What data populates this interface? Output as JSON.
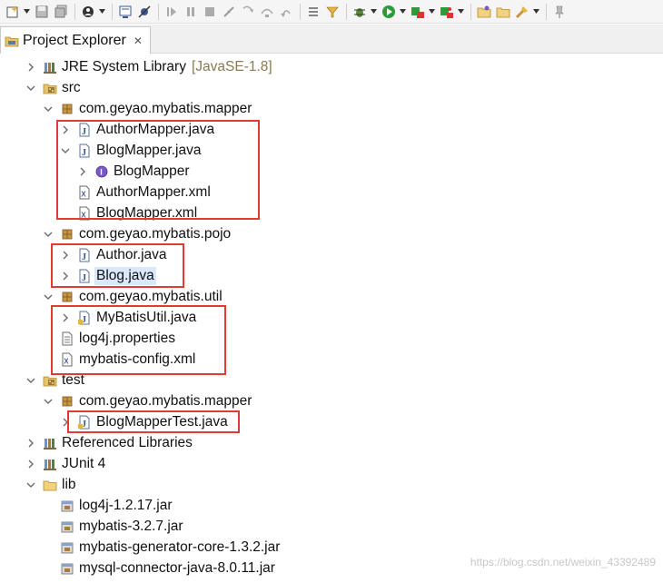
{
  "colors": {
    "highlight_box": "#e53935",
    "selection_bg": "#d9e8fb",
    "decoration": "#8a7a55",
    "package_icon": "#b07a2d",
    "java_icon": "#4a6aa5",
    "interface_icon": "#7a4dbd"
  },
  "toolbar": {
    "buttons": [
      "new-wizard-icon",
      "save-icon",
      "save-all-icon",
      "perspective-icon",
      "console-icon",
      "skip-breakpoints-icon",
      "resume-icon",
      "suspend-icon",
      "terminate-icon",
      "disconnect-icon",
      "step-into-icon",
      "step-over-icon",
      "step-return-icon",
      "drop-to-frame-icon",
      "use-step-filters-icon",
      "debug-icon",
      "run-icon",
      "coverage-icon",
      "external-tools-icon",
      "open-type-icon",
      "open-task-icon",
      "search-icon",
      "pin-icon"
    ]
  },
  "tab": {
    "label": "Project Explorer",
    "close_symbol": "✕"
  },
  "tree": {
    "jre": {
      "label": "JRE System Library",
      "decoration": "[JavaSE-1.8]"
    },
    "src": {
      "label": "src"
    },
    "pkg_mapper": {
      "label": "com.geyao.mybatis.mapper"
    },
    "author_mapper_java": {
      "label": "AuthorMapper.java"
    },
    "blog_mapper_java": {
      "label": "BlogMapper.java"
    },
    "blog_mapper_iface": {
      "label": "BlogMapper"
    },
    "author_mapper_xml": {
      "label": "AuthorMapper.xml"
    },
    "blog_mapper_xml": {
      "label": "BlogMapper.xml"
    },
    "pkg_pojo": {
      "label": "com.geyao.mybatis.pojo"
    },
    "author_java": {
      "label": "Author.java"
    },
    "blog_java": {
      "label": "Blog.java"
    },
    "pkg_util": {
      "label": "com.geyao.mybatis.util"
    },
    "mybatis_util_java": {
      "label": "MyBatisUtil.java"
    },
    "log4j_properties": {
      "label": "log4j.properties"
    },
    "mybatis_config_xml": {
      "label": "mybatis-config.xml"
    },
    "test": {
      "label": "test"
    },
    "test_pkg_mapper": {
      "label": "com.geyao.mybatis.mapper"
    },
    "blog_mapper_test_java": {
      "label": "BlogMapperTest.java"
    },
    "referenced_libraries": {
      "label": "Referenced Libraries"
    },
    "junit4": {
      "label": "JUnit 4"
    },
    "lib": {
      "label": "lib"
    },
    "log4j_jar": {
      "label": "log4j-1.2.17.jar"
    },
    "mybatis_jar": {
      "label": "mybatis-3.2.7.jar"
    },
    "generator_jar": {
      "label": "mybatis-generator-core-1.3.2.jar"
    },
    "mysql_jar": {
      "label": "mysql-connector-java-8.0.11.jar"
    }
  },
  "watermark": "https://blog.csdn.net/weixin_43392489"
}
